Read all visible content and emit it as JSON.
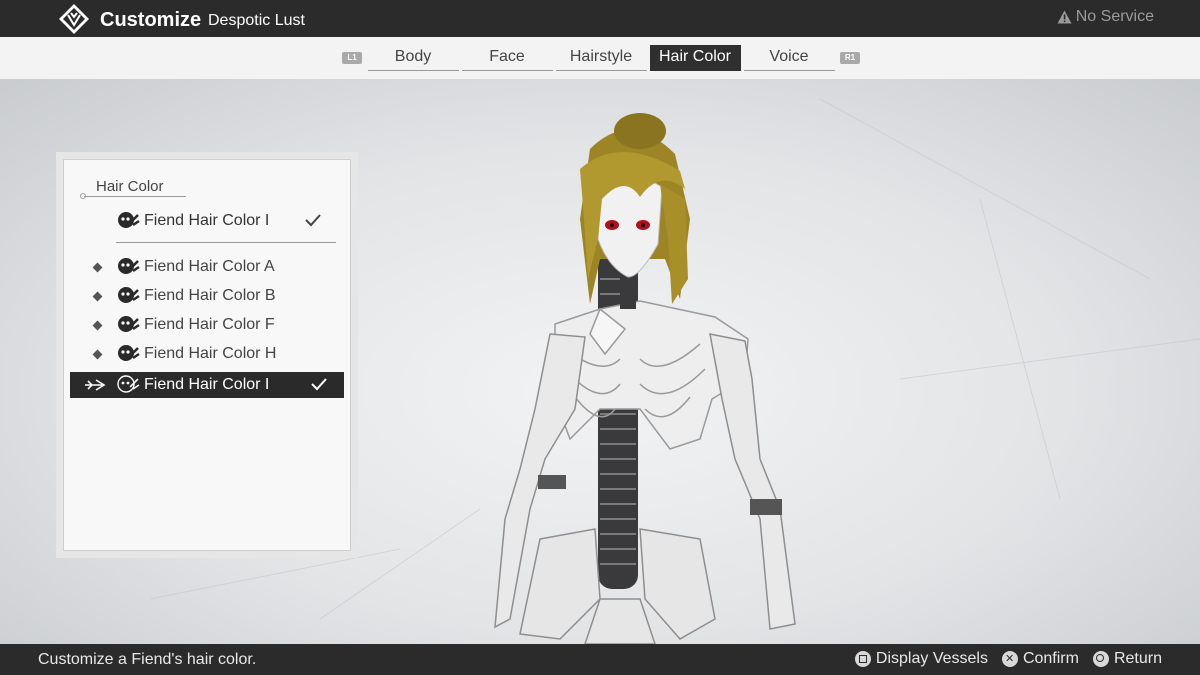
{
  "header": {
    "title": "Customize",
    "subtitle": "Despotic Lust",
    "network_status": "No Service",
    "logo_icon": "demon-sigil-icon",
    "warning_icon": "warning-triangle-icon"
  },
  "tabs": {
    "left_shoulder": "L1",
    "right_shoulder": "R1",
    "items": [
      {
        "label": "Body",
        "active": false
      },
      {
        "label": "Face",
        "active": false
      },
      {
        "label": "Hairstyle",
        "active": false
      },
      {
        "label": "Hair Color",
        "active": true
      },
      {
        "label": "Voice",
        "active": false
      }
    ]
  },
  "panel": {
    "heading": "Hair Color",
    "current": "Fiend Hair Color I",
    "items": [
      {
        "label": "Fiend Hair Color A",
        "selected": false
      },
      {
        "label": "Fiend Hair Color B",
        "selected": false
      },
      {
        "label": "Fiend Hair Color F",
        "selected": false
      },
      {
        "label": "Fiend Hair Color H",
        "selected": false
      },
      {
        "label": "Fiend Hair Color I",
        "selected": true
      }
    ]
  },
  "footer": {
    "hint": "Customize a Fiend's hair color.",
    "buttons": [
      {
        "icon": "square-button-icon",
        "label": "Display Vessels"
      },
      {
        "icon": "cross-button-icon",
        "label": "Confirm"
      },
      {
        "icon": "circle-button-icon",
        "label": "Return"
      }
    ]
  },
  "colors": {
    "bar": "#2b2b2c",
    "tab_active": "#2f2f30",
    "selected_row": "#2a2a2b",
    "hair": "#a98f2a",
    "eyes": "#b0101a"
  }
}
